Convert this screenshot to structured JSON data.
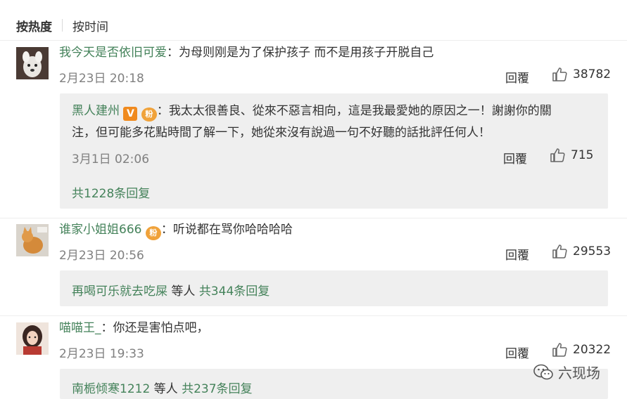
{
  "sort": {
    "active": "按热度",
    "inactive": "按时间"
  },
  "comments": [
    {
      "username": "我今天是否依旧可爱",
      "separator": "：",
      "text": "为母则刚是为了保护孩子 而不是用孩子开脱自己",
      "time": "2月23日 20:18",
      "reply_label": "回覆",
      "likes": "38782",
      "replies": {
        "username": "黑人建州",
        "badge_v": "V",
        "badge_fan": "粉",
        "separator": "：",
        "line1": "我太太很善良、從來不惡言相向，這是我最愛她的原因之一！謝謝你的關",
        "line2": "注，但可能多花點時間了解一下，她從來沒有說過一句不好聽的話批評任何人！",
        "time": "3月1日 02:06",
        "reply_label": "回覆",
        "likes": "715",
        "total": "共1228条回复"
      }
    },
    {
      "username": "谁家小姐姐666",
      "badge_fan": "粉",
      "separator": "：",
      "text": "听说都在骂你哈哈哈哈",
      "time": "2月23日 20:56",
      "reply_label": "回覆",
      "likes": "29553",
      "reply_summary": {
        "user": "再喝可乐就去吃屎",
        "and_others": " 等人 ",
        "total": "共344条回复"
      }
    },
    {
      "username": "喵喵王_",
      "separator": "：",
      "text": "你还是害怕点吧，",
      "time": "2月23日 19:33",
      "reply_label": "回覆",
      "likes": "20322",
      "reply_summary": {
        "user": "南栀倾寒1212",
        "and_others": " 等人 ",
        "total": "共237条回复"
      }
    }
  ],
  "watermark": {
    "text": "六现场",
    "icon": "wechat-icon"
  },
  "colors": {
    "username": "#44825a",
    "meta": "#808080",
    "reply_bg": "#efefef"
  }
}
